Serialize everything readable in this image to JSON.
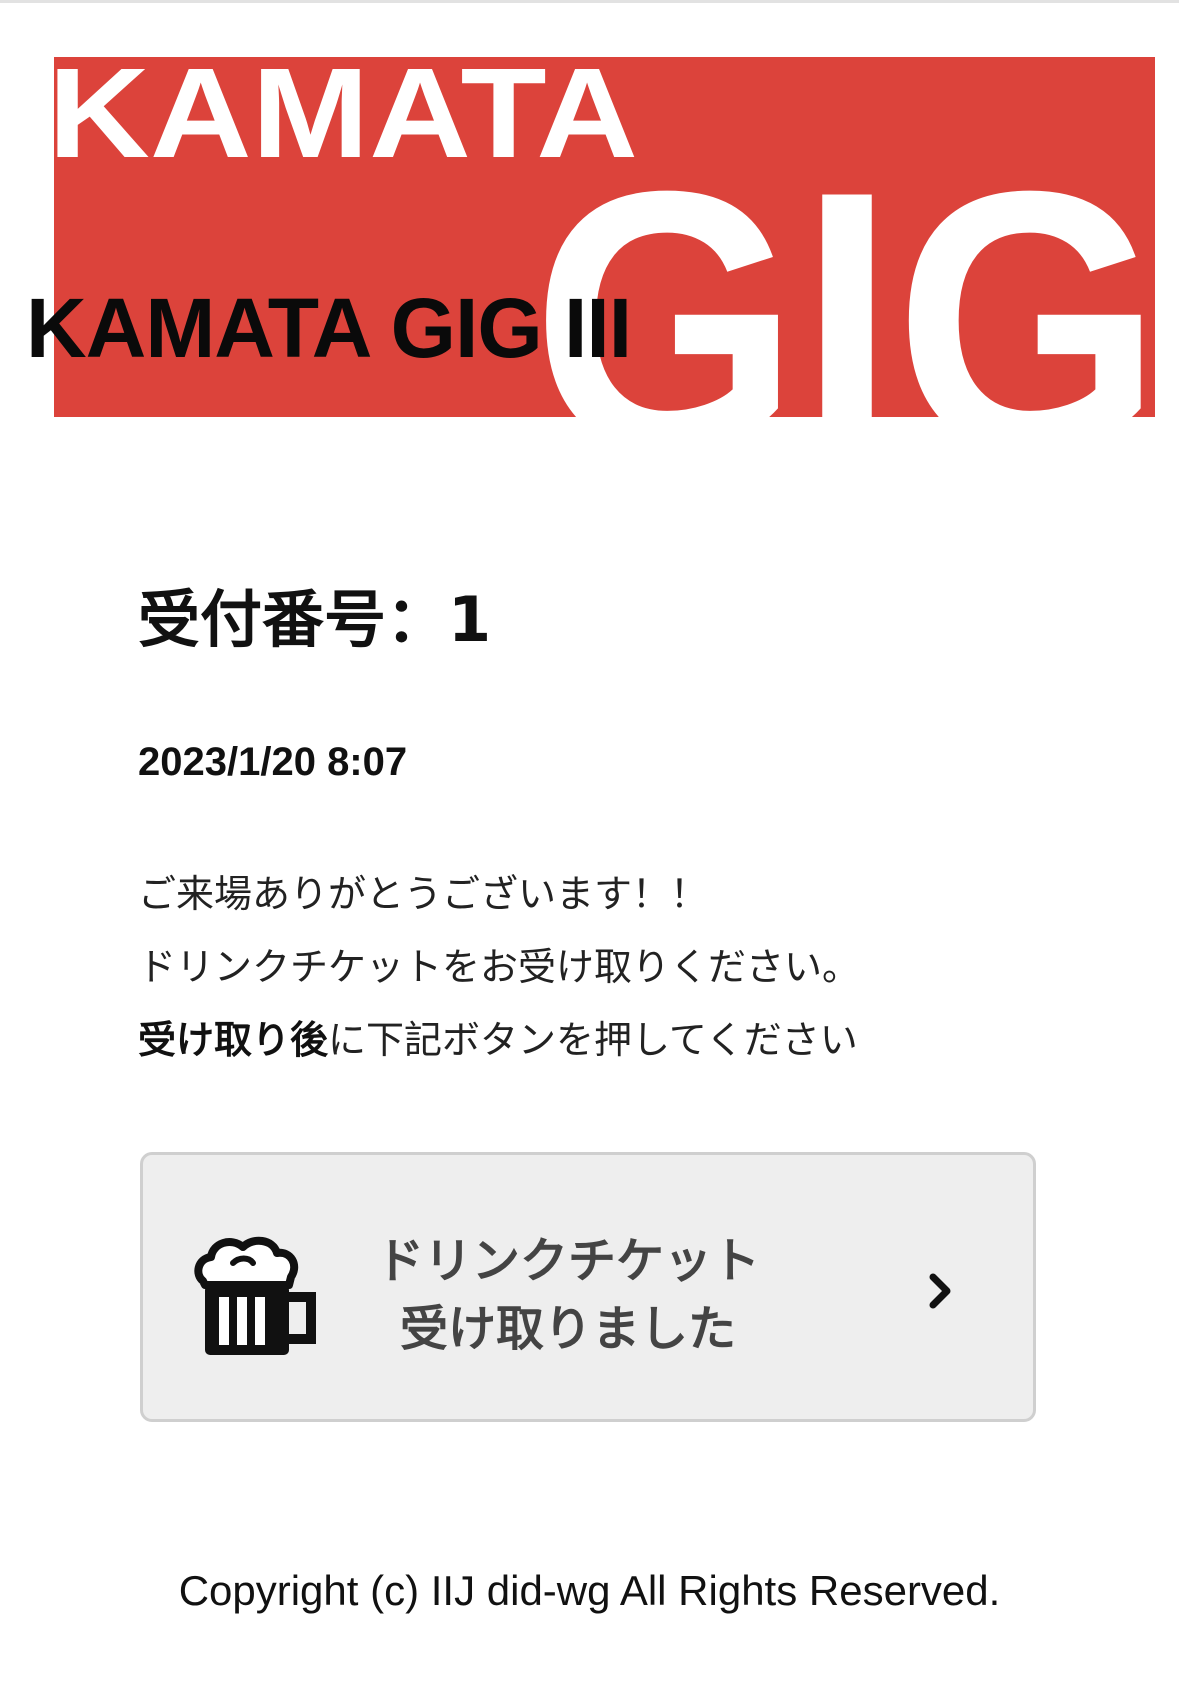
{
  "logo": {
    "top_word": "KAMATA",
    "big_word": "GIG",
    "background_color": "#dc433b"
  },
  "event_title": "KAMATA GIG III",
  "receipt": {
    "label": "受付番号：1"
  },
  "datetime": "2023/1/20 8:07",
  "message": {
    "line1": "ご来場ありがとうございます！！",
    "line2": "ドリンクチケットをお受け取りください。",
    "line3_bold": "受け取り後",
    "line3_rest": "に下記ボタンを押してください"
  },
  "drink_button": {
    "line1": "ドリンクチケット",
    "line2": "受け取りました",
    "icon": "beer-mug-icon",
    "chevron": "chevron-right-icon"
  },
  "footer": {
    "copyright": "Copyright (c) IIJ did-wg All Rights Reserved."
  }
}
